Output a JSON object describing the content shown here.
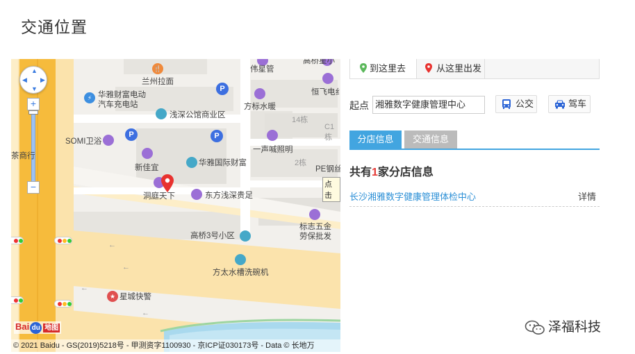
{
  "page": {
    "title": "交通位置"
  },
  "map": {
    "pois": {
      "lanzhou": "兰州拉面",
      "weixing": "伟星管",
      "gaoqiao_top": "高桥星小",
      "hengfei": "恒飞电纟",
      "huaya_charge_1": "华雅财富电动",
      "huaya_charge_2": "汽车充电站",
      "qianshen_mall": "浅深公馆商业区",
      "fangbiao": "方标水暖",
      "somi": "SOMI卫浴",
      "yisheng": "一声喊照明",
      "cha": "茶商行",
      "xinjiayi": "新佳宜",
      "huaya_intl": "华雅国际财富",
      "pe": "PE钢丝",
      "dongting": "洞庭天下",
      "dongfang": "东方浅深贵足",
      "biaozhi_1": "标志五金",
      "biaozhi_2": "劳保批发",
      "gaoqiao3": "高桥3号小区",
      "fangtai": "方太水槽洗碗机",
      "xingcheng": "星城快警"
    },
    "buildings": {
      "b14": "14栋",
      "c1": "C1栋",
      "b2": "2栋"
    },
    "click_tip": "点击",
    "copyright": "© 2021 Baidu - GS(2019)5218号 - 甲测资字1100930 - 京ICP证030173号 - Data © 长地万",
    "logo": {
      "bai": "Bai",
      "du": "du",
      "ditu": "地图"
    }
  },
  "route": {
    "tab_to": "到这里去",
    "tab_from": "从这里出发",
    "start_label": "起点",
    "start_value": "湘雅数字健康管理中心",
    "bus_label": "公交",
    "car_label": "驾车"
  },
  "info_tabs": {
    "branch": "分店信息",
    "traffic": "交通信息"
  },
  "branches": {
    "count_prefix": "共有",
    "count": "1",
    "count_suffix": "家分店信息",
    "items": [
      {
        "name": "长沙湘雅数字健康管理体检中心",
        "detail": "详情"
      }
    ]
  },
  "watermark": {
    "text": "泽福科技"
  },
  "colors": {
    "accent": "#42a5e0",
    "link": "#2b8fd6",
    "count_red": "#e53935"
  }
}
